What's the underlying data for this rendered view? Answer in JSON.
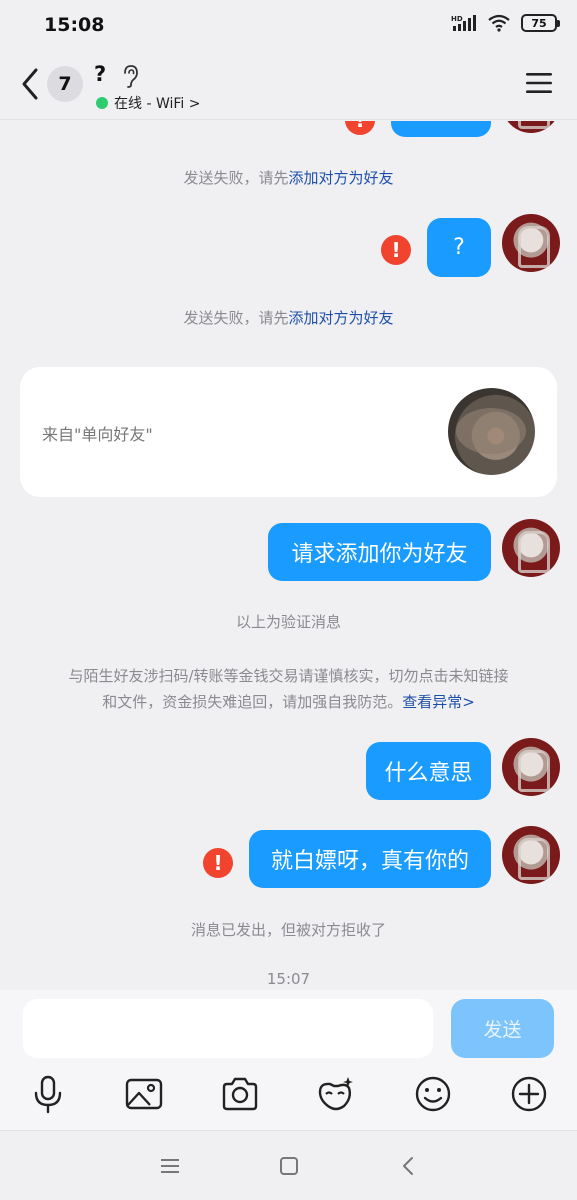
{
  "status_bar": {
    "time": "15:08",
    "network": "HD",
    "battery": "75"
  },
  "header": {
    "unread_count": "7",
    "contact_name": "?",
    "online_status": "在线 - WiFi >"
  },
  "messages": {
    "fail_notice_prefix": "发送失败，请先",
    "fail_notice_link": "添加对方为好友",
    "bubble_question": "?",
    "card_source": "来自\"单向好友\"",
    "bubble_request": "请求添加你为好友",
    "verify_note": "以上为验证消息",
    "warning_line1": "与陌生好友涉扫码/转账等金钱交易请谨慎核实，切勿点击未知链接",
    "warning_line2": "和文件，资金损失难追回，请加强自我防范。",
    "warning_link": "查看异常>",
    "bubble_meaning": "什么意思",
    "bubble_freeload": "就白嫖呀，真有你的",
    "rejected_note": "消息已发出，但被对方拒收了",
    "timestamp": "15:07",
    "error_mark": "!"
  },
  "input": {
    "placeholder": "",
    "send_label": "发送"
  },
  "colors": {
    "bubble": "#1a9bff",
    "error": "#f0442f",
    "link": "#1e4fa8",
    "online": "#2ecc71"
  }
}
